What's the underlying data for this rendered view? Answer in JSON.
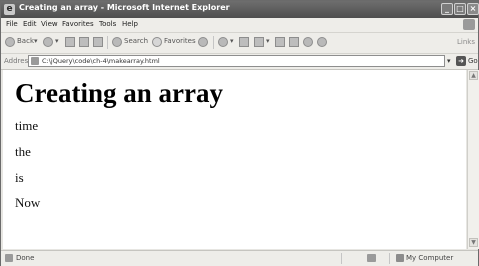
{
  "window": {
    "title": "Creating an array - Microsoft Internet Explorer",
    "controls": {
      "minimize": "_",
      "maximize": "□",
      "close": "×"
    }
  },
  "menu": [
    "File",
    "Edit",
    "View",
    "Favorites",
    "Tools",
    "Help"
  ],
  "toolbar": {
    "back_label": "Back",
    "search_label": "Search",
    "favorites_label": "Favorites",
    "links_label": "Links"
  },
  "address": {
    "label": "Address",
    "url": "C:\\jQuery\\code\\ch-4\\makearray.html",
    "go_label": "Go"
  },
  "page": {
    "heading": "Creating an array",
    "items": [
      "time",
      "the",
      "is",
      "Now"
    ]
  },
  "status": {
    "text": "Done",
    "zone": "My Computer"
  }
}
